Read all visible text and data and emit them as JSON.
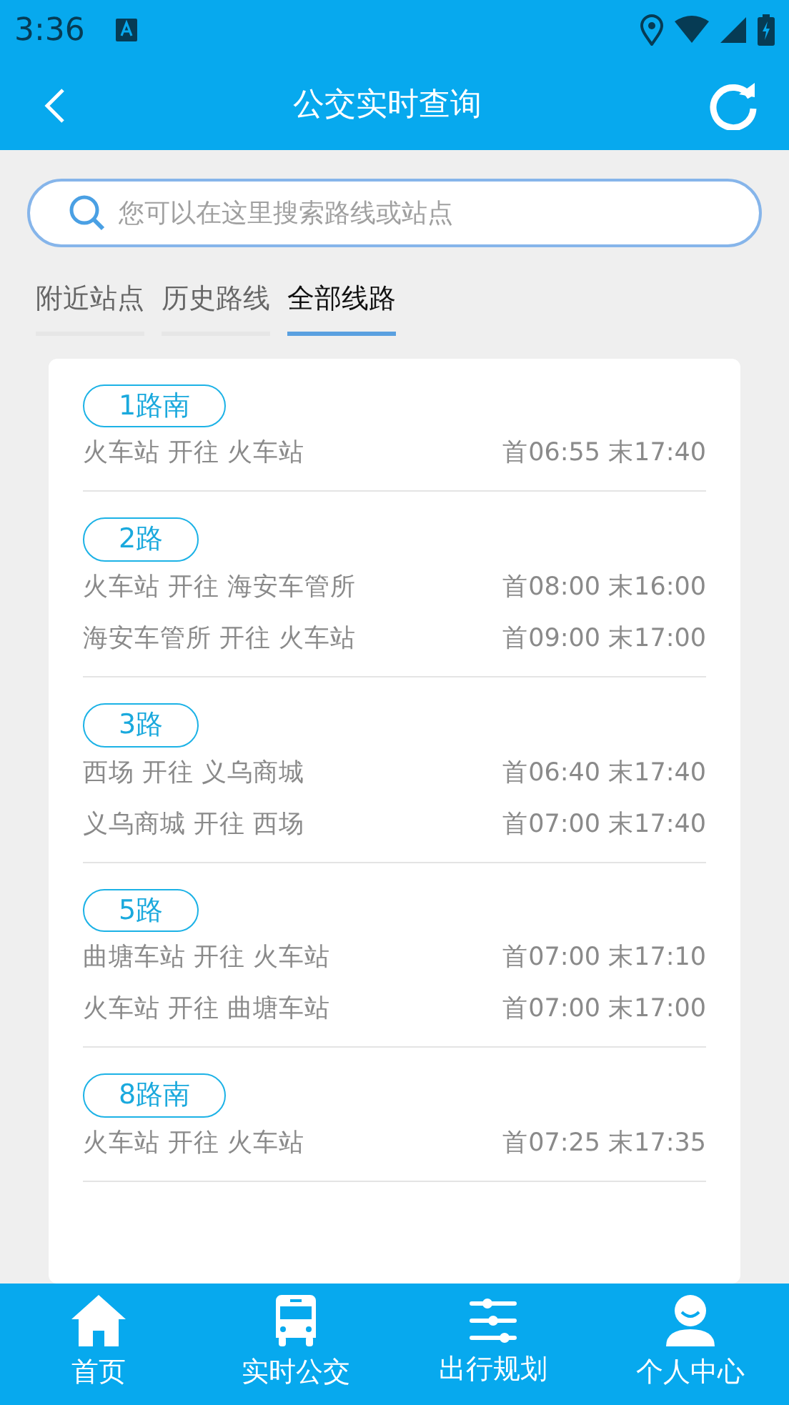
{
  "status_bar": {
    "time": "3:36"
  },
  "app_bar": {
    "title": "公交实时查询"
  },
  "search": {
    "placeholder": "您可以在这里搜索路线或站点"
  },
  "tabs": [
    {
      "label": "附近站点",
      "selected": false
    },
    {
      "label": "历史路线",
      "selected": false
    },
    {
      "label": "全部线路",
      "selected": true
    }
  ],
  "routes": [
    {
      "name": "1路南",
      "directions": [
        {
          "text": "火车站 开往 火车站",
          "times": "首06:55 末17:40"
        }
      ]
    },
    {
      "name": "2路",
      "directions": [
        {
          "text": "火车站 开往 海安车管所",
          "times": "首08:00 末16:00"
        },
        {
          "text": "海安车管所 开往 火车站",
          "times": "首09:00 末17:00"
        }
      ]
    },
    {
      "name": "3路",
      "directions": [
        {
          "text": "西场 开往 义乌商城",
          "times": "首06:40 末17:40"
        },
        {
          "text": "义乌商城 开往 西场",
          "times": "首07:00 末17:40"
        }
      ]
    },
    {
      "name": "5路",
      "directions": [
        {
          "text": "曲塘车站 开往 火车站",
          "times": "首07:00 末17:10"
        },
        {
          "text": "火车站 开往 曲塘车站",
          "times": "首07:00 末17:00"
        }
      ]
    },
    {
      "name": "8路南",
      "directions": [
        {
          "text": "火车站 开往 火车站",
          "times": "首07:25 末17:35"
        }
      ]
    }
  ],
  "bottom_nav": [
    {
      "label": "首页"
    },
    {
      "label": "实时公交"
    },
    {
      "label": "出行规划"
    },
    {
      "label": "个人中心"
    }
  ]
}
